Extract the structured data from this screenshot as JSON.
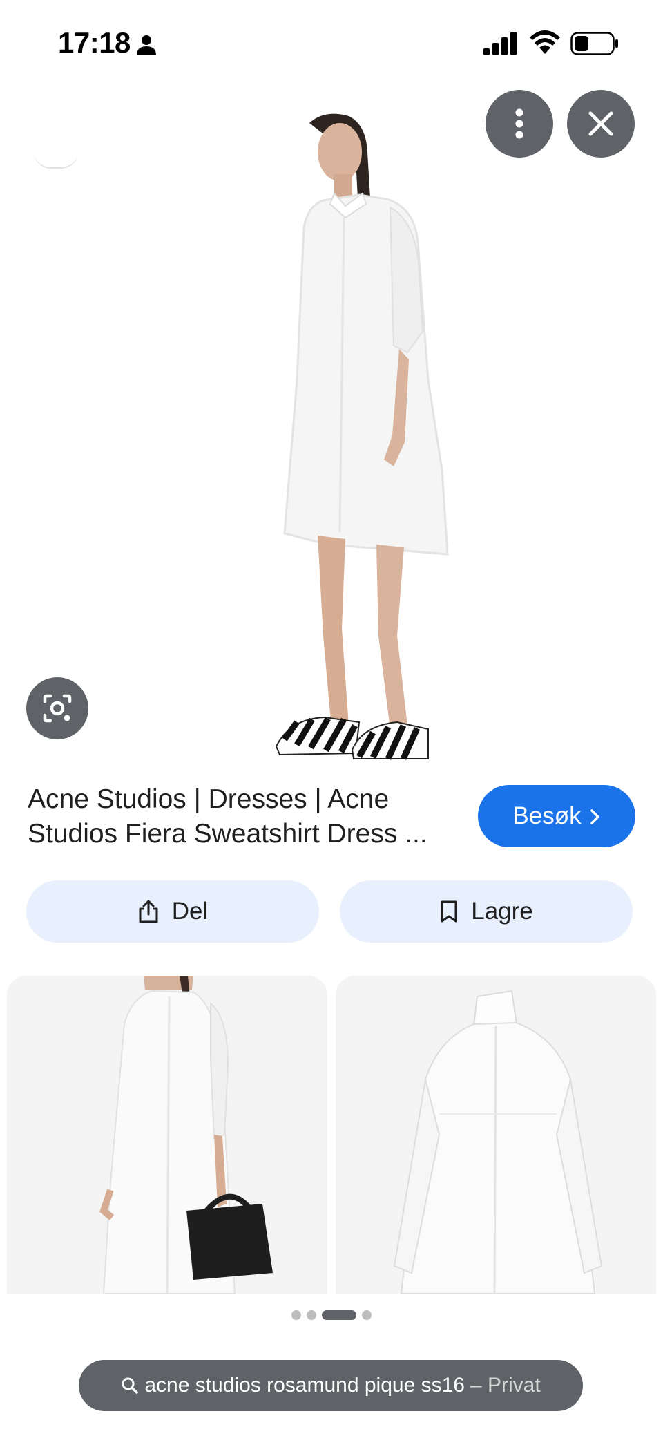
{
  "status_bar": {
    "time": "17:18",
    "icons": [
      "person-icon",
      "signal-icon",
      "wifi-icon",
      "battery-icon"
    ]
  },
  "viewer": {
    "more_icon": "more-vert-icon",
    "close_icon": "close-icon",
    "lens_icon": "google-lens-icon"
  },
  "result": {
    "title": "Acne Studios | Dresses | Acne Studios Fiera Sweatshirt Dress ...",
    "visit_label": "Besøk"
  },
  "actions": {
    "share_label": "Del",
    "save_label": "Lagre"
  },
  "pagination": {
    "pages": 4,
    "active_page": 3
  },
  "search": {
    "query": "acne studios rosamund pique ss16",
    "mode": "– Privat"
  },
  "colors": {
    "accent": "#1a73e8",
    "action_bg": "#e8f0fe",
    "overlay_button": "#5f6368",
    "text": "#1f1f1f"
  }
}
